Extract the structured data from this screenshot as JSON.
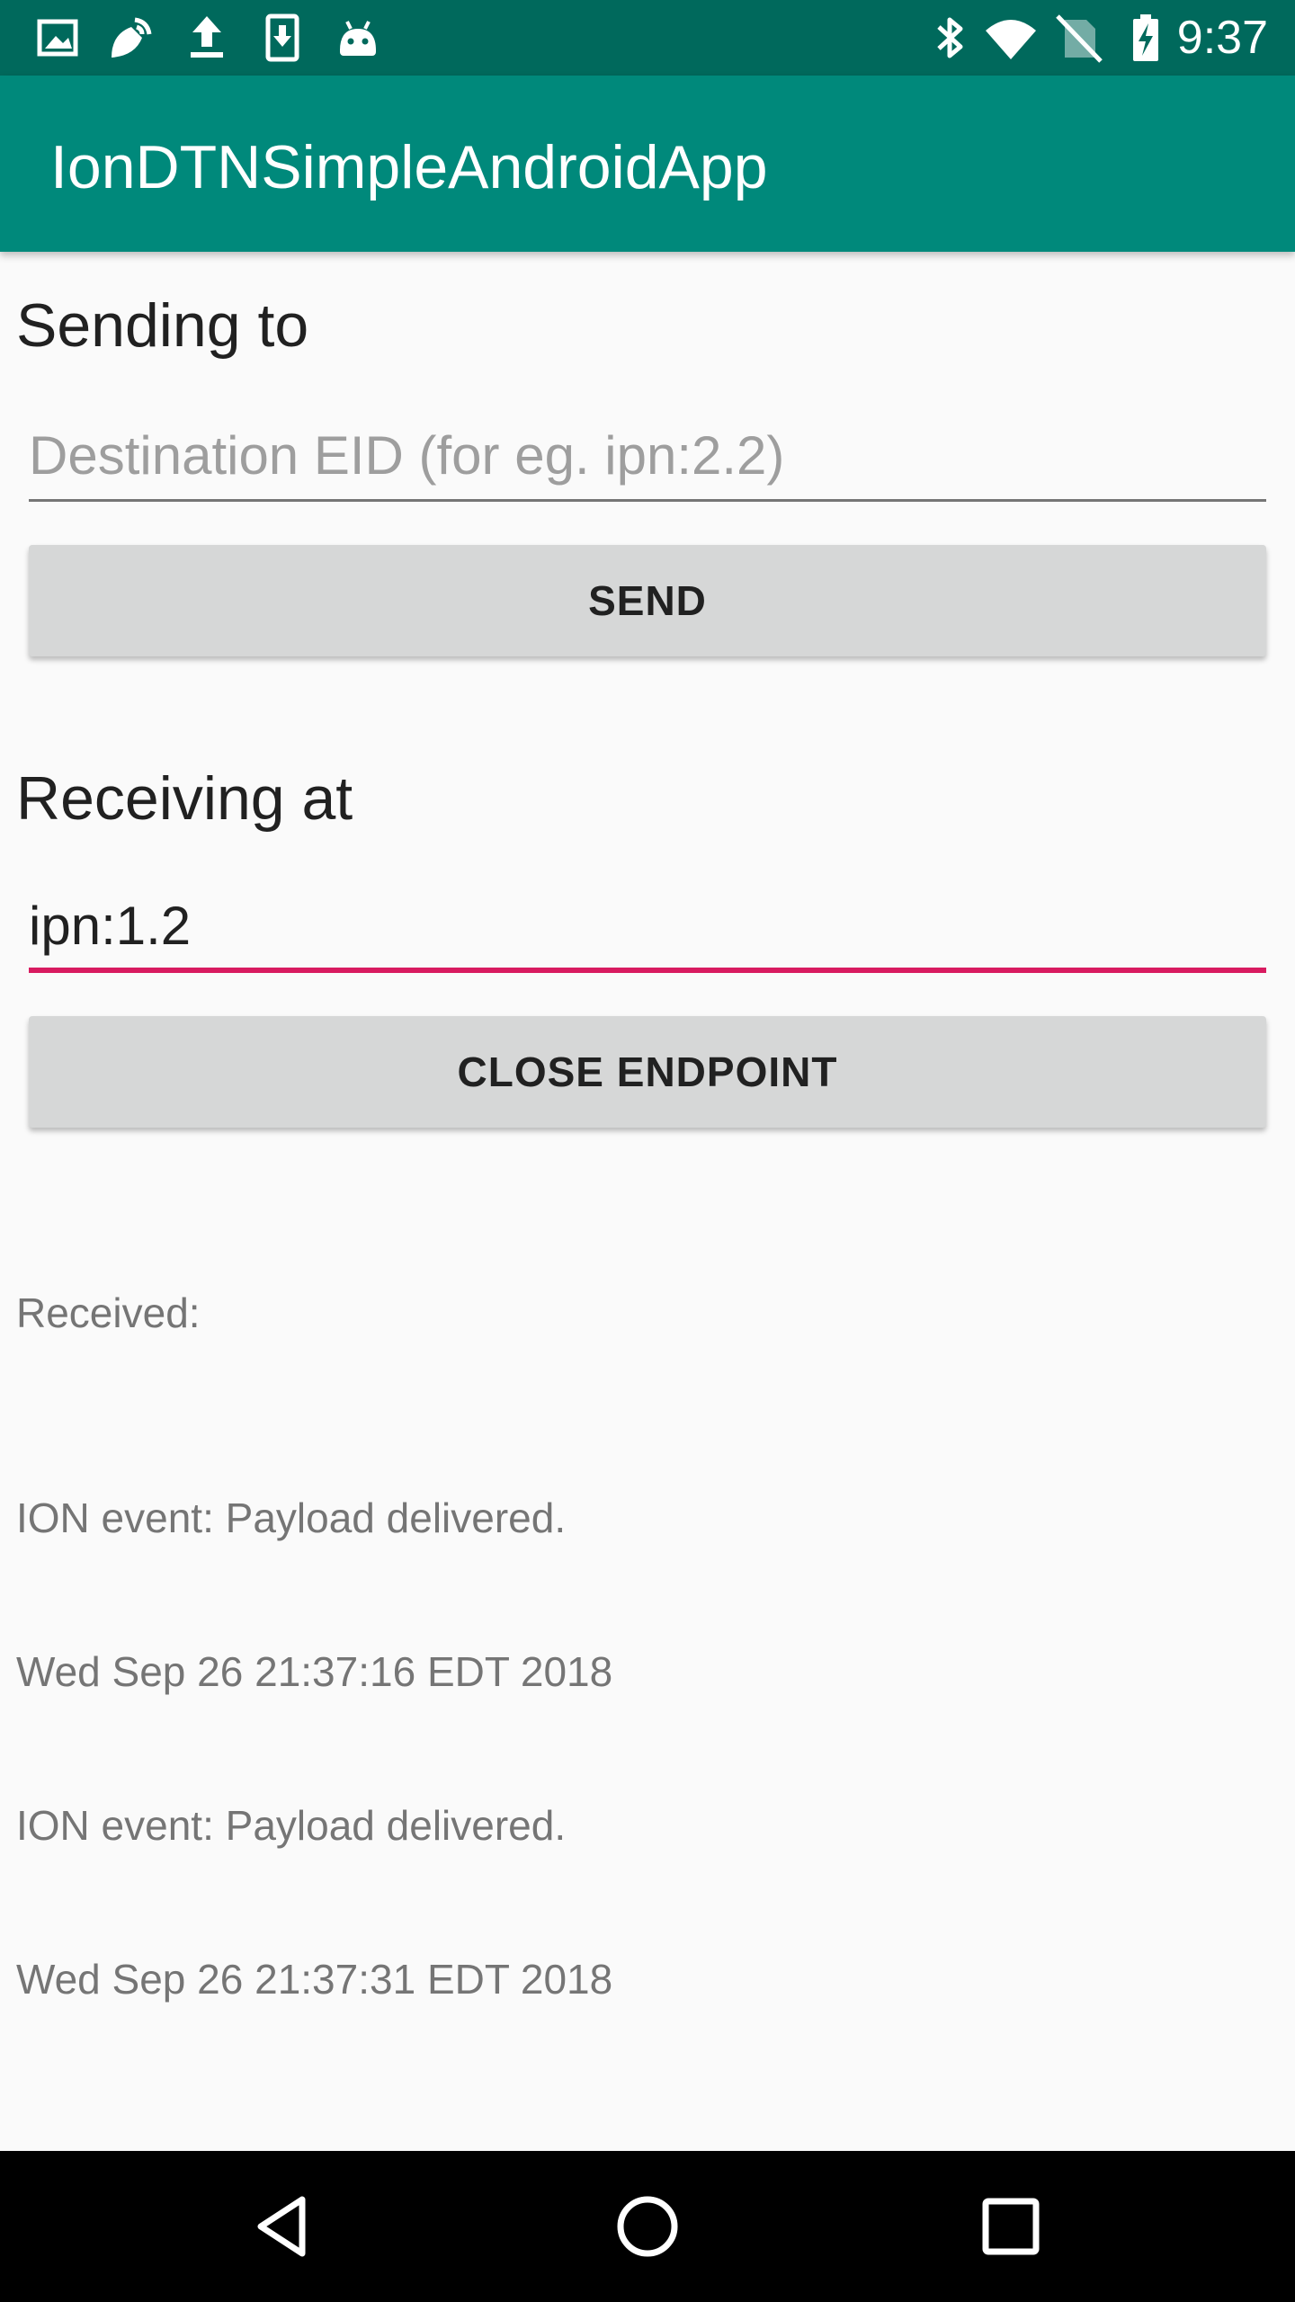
{
  "status_bar": {
    "time": "9:37",
    "left_icons": [
      "image-icon",
      "cast-icon",
      "upload-icon",
      "download-icon",
      "android-icon"
    ],
    "right_icons": [
      "bluetooth-icon",
      "wifi-icon",
      "no-sim-icon",
      "battery-charging-icon"
    ]
  },
  "app_bar": {
    "title": "IonDTNSimpleAndroidApp"
  },
  "sending": {
    "heading": "Sending to",
    "destination_placeholder": "Destination EID (for eg. ipn:2.2)",
    "destination_value": "",
    "send_label": "SEND"
  },
  "receiving": {
    "heading": "Receiving at",
    "endpoint_value": "ipn:1.2",
    "close_label": "CLOSE ENDPOINT"
  },
  "received": {
    "label": "Received:",
    "lines": [
      "ION event: Payload delivered.",
      "Wed Sep 26 21:37:16 EDT 2018",
      "ION event: Payload delivered.",
      "Wed Sep 26 21:37:31 EDT 2018"
    ]
  },
  "nav_bar": {
    "buttons": [
      "back-icon",
      "home-icon",
      "recents-icon"
    ]
  },
  "colors": {
    "status_bar": "#00695c",
    "app_bar": "#00897b",
    "accent": "#d81b60",
    "button": "#d6d7d7"
  }
}
